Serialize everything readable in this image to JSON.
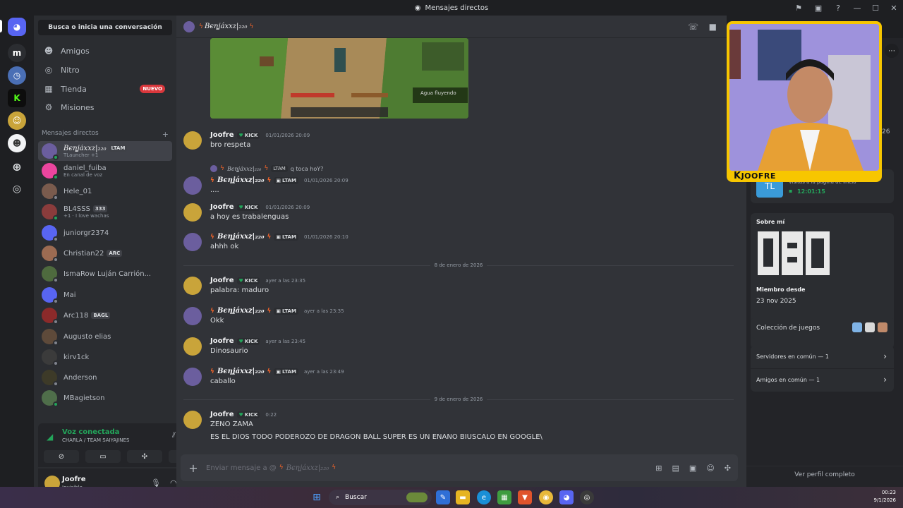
{
  "window": {
    "title": "Mensajes directos"
  },
  "sidebar": {
    "search_placeholder": "Busca o inicia una conversación",
    "nav": [
      {
        "label": "Amigos",
        "icon": "friends-icon"
      },
      {
        "label": "Nitro",
        "icon": "nitro-icon"
      },
      {
        "label": "Tienda",
        "icon": "shop-icon",
        "badge": "NUEVO"
      },
      {
        "label": "Misiones",
        "icon": "quests-icon"
      }
    ],
    "dm_header": "Mensajes directos",
    "dms": [
      {
        "name": "Bєηʝáxxz|₂₂₀",
        "sub": "TLauncher +1",
        "tag": "LTAM",
        "online": true,
        "color": "#6b5e9e"
      },
      {
        "name": "daniel_fuiba",
        "sub": "En canal de voz",
        "online": true,
        "color": "#eb459e"
      },
      {
        "name": "Hele_01",
        "sub": "",
        "online": false,
        "color": "#7a5b4d"
      },
      {
        "name": "BL4SSS",
        "sub": "+1 · I love wachas",
        "tag": "333",
        "online": true,
        "color": "#8a3c3c"
      },
      {
        "name": "juniorgr2374",
        "sub": "",
        "online": false,
        "color": "#5865f2"
      },
      {
        "name": "Christian22",
        "sub": "",
        "tag": "ARC",
        "online": false,
        "color": "#9c6b52"
      },
      {
        "name": "IsmaRow Luján Carrión...",
        "sub": "",
        "online": false,
        "color": "#4e6a3e"
      },
      {
        "name": "Mai",
        "sub": "",
        "online": false,
        "color": "#5865f2"
      },
      {
        "name": "Arc118",
        "sub": "",
        "tag": "BAGL",
        "online": false,
        "color": "#8c2a2a"
      },
      {
        "name": "Augusto elias",
        "sub": "",
        "online": false,
        "color": "#5e4a3a"
      },
      {
        "name": "kirv1ck",
        "sub": "",
        "online": false,
        "color": "#3b3b3b"
      },
      {
        "name": "Anderson",
        "sub": "",
        "online": false,
        "color": "#3d3a28"
      },
      {
        "name": "MBagietson",
        "sub": "",
        "online": true,
        "color": "#4f6e4a"
      }
    ],
    "voice": {
      "status": "Voz conectada",
      "channel": "CHARLA / TEAM SAIYAJINES"
    },
    "user": {
      "name": "Joofre",
      "status": "Invisible"
    }
  },
  "chat": {
    "recipient": "Bєηʝáxxz|₂₂₀",
    "embed_caption": "Agua fluyendo",
    "messages": [
      {
        "author": "Joofre",
        "badge": "KICK",
        "time": "01/01/2026 20:09",
        "text": "bro respeta"
      },
      {
        "author": "Bєηʝáxxz|₂₂₀",
        "badge": "LTAM",
        "time": "01/01/2026 20:09",
        "text": "....",
        "reply_author": "Bєηʝáxxz|₂₂₀",
        "reply_badge": "LTAM",
        "reply_text": "q toca hoY?"
      },
      {
        "author": "Joofre",
        "badge": "KICK",
        "time": "01/01/2026 20:09",
        "text": "a hoy es trabalenguas"
      },
      {
        "author": "Bєηʝáxxz|₂₂₀",
        "badge": "LTAM",
        "time": "01/01/2026 20:10",
        "text": "ahhh ok"
      },
      {
        "author": "Joofre",
        "badge": "KICK",
        "time": "ayer a las 23:35",
        "text": "palabra: maduro"
      },
      {
        "author": "Bєηʝáxxz|₂₂₀",
        "badge": "LTAM",
        "time": "ayer a las 23:35",
        "text": "Okk"
      },
      {
        "author": "Joofre",
        "badge": "KICK",
        "time": "ayer a las 23:45",
        "text": "Dinosaurio"
      },
      {
        "author": "Bєηʝáxxz|₂₂₀",
        "badge": "LTAM",
        "time": "ayer a las 23:49",
        "text": "caballo"
      },
      {
        "author": "Joofre",
        "badge": "KICK",
        "time": "0:22",
        "text": "ZENO ZAMA",
        "text2": "ES EL DIOS TODO PODEROZO DE DRAGON BALL SUPER ES UN ENANO BIUSCALO EN GOOGLE\\"
      }
    ],
    "dividers": [
      "8 de enero de 2026",
      "9 de enero de 2026"
    ],
    "composer_placeholder": "Enviar mensaje a @",
    "composer_target": "Bєηʝáxxz|₂₂₀"
  },
  "profile": {
    "activity_text": "Visitas a la pagina de inicio",
    "activity_time": "12:01:15",
    "about_label": "Sobre mí",
    "member_since_label": "Miembro desde",
    "member_since": "23 nov 2025",
    "games_label": "Colección de juegos",
    "servers_label": "Servidores en común — 1",
    "friends_label": "Amigos en común — 1",
    "view_full": "Ver perfil completo",
    "stat_26": "26"
  },
  "webcam": {
    "caption": "JOOFRE"
  },
  "taskbar": {
    "search": "Buscar",
    "time": "00:23",
    "date": "9/1/2026"
  },
  "colors": {
    "accent": "#5865f2",
    "online": "#23a55a",
    "kick": "#53fc18",
    "webcam_border": "#f7c600"
  }
}
